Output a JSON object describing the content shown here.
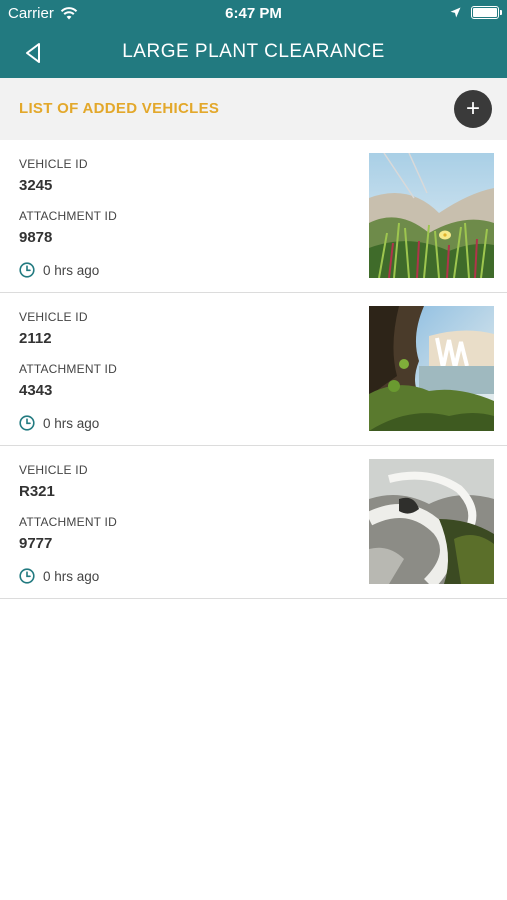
{
  "status_bar": {
    "carrier": "Carrier",
    "time": "6:47 PM"
  },
  "header": {
    "title": "LARGE PLANT CLEARANCE"
  },
  "section": {
    "title": "LIST OF ADDED VEHICLES",
    "add_label": "+"
  },
  "items": [
    {
      "vehicle_label": "VEHICLE ID",
      "vehicle_id": "3245",
      "attachment_label": "ATTACHMENT ID",
      "attachment_id": "9878",
      "time_ago": "0 hrs ago",
      "image": "meadow-flower-photo"
    },
    {
      "vehicle_label": "VEHICLE ID",
      "vehicle_id": "2112",
      "attachment_label": "ATTACHMENT ID",
      "attachment_id": "4343",
      "time_ago": "0 hrs ago",
      "image": "waterfall-cliff-photo"
    },
    {
      "vehicle_label": "VEHICLE ID",
      "vehicle_id": "R321",
      "attachment_label": "ATTACHMENT ID",
      "attachment_id": "9777",
      "time_ago": "0 hrs ago",
      "image": "stream-rocks-photo"
    }
  ],
  "colors": {
    "header": "#227a80",
    "accent": "#e3a82b",
    "add_button": "#3a3a3a"
  }
}
